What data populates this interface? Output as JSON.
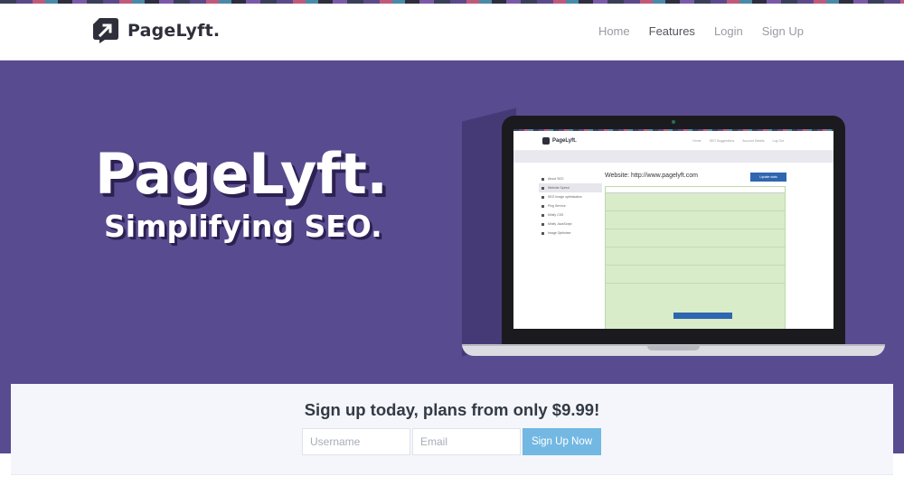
{
  "brand": {
    "name": "PageLyft."
  },
  "nav": {
    "home": "Home",
    "features": "Features",
    "login": "Login",
    "signup": "Sign Up"
  },
  "hero": {
    "title": "PageLyft.",
    "subtitle": "Simplifying SEO."
  },
  "mockup": {
    "brand": "PageLyft.",
    "nav": [
      "Home",
      "SEO Suggestions",
      "Account Details",
      "Log Out"
    ],
    "sidebar": [
      "About SEO",
      "Website Speed",
      "SEO Image optimisation",
      "Ping Service",
      "Minify CSS",
      "Minify JavaScript",
      "Image Optimiser"
    ],
    "heading": "Website: http://www.pagelyft.com",
    "update_button": "Update stats"
  },
  "signup": {
    "title": "Sign up today, plans from only $9.99!",
    "username_placeholder": "Username",
    "email_placeholder": "Email",
    "button": "Sign Up Now"
  },
  "colors": {
    "hero_bg": "#594b8f",
    "button": "#73b8e3",
    "text_dark": "#333a45"
  }
}
